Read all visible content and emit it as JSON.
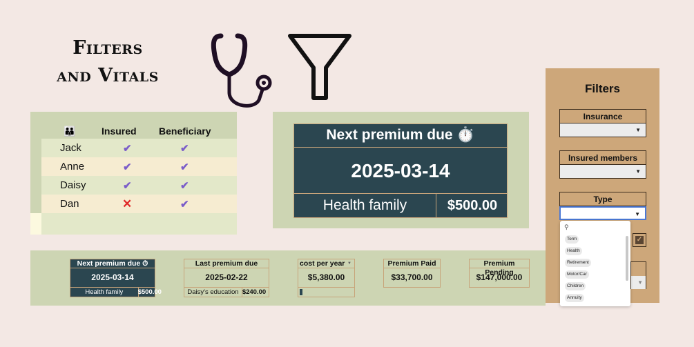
{
  "title": {
    "line1": "Filters",
    "line2": "and Vitals"
  },
  "icons": {
    "stethoscope": "stethoscope-icon",
    "funnel": "funnel-icon"
  },
  "members_table": {
    "header_icon": "👪",
    "col_insured": "Insured",
    "col_beneficiary": "Beneficiary",
    "rows": [
      {
        "name": "Jack",
        "insured": "✔",
        "beneficiary": "✔"
      },
      {
        "name": "Anne",
        "insured": "✔",
        "beneficiary": "✔"
      },
      {
        "name": "Daisy",
        "insured": "✔",
        "beneficiary": "✔"
      },
      {
        "name": "Dan",
        "insured": "✕",
        "beneficiary": "✔"
      }
    ]
  },
  "big_card": {
    "title": "Next premium due ⏱️",
    "date": "2025-03-14",
    "policy": "Health family",
    "amount": "$500.00"
  },
  "summary": {
    "next_premium": {
      "label": "Next premium due ⏱",
      "date": "2025-03-14",
      "policy": "Health family",
      "amount": "$500.00"
    },
    "last_premium": {
      "label": "Last premium due",
      "date": "2025-02-22",
      "policy": "Daisy's education",
      "amount": "$240.00"
    },
    "cost_per_year": {
      "label": "cost per year",
      "value": "$5,380.00",
      "progress": 0.05
    },
    "premium_paid": {
      "label": "Premium Paid",
      "value": "$33,700.00"
    },
    "premium_pending": {
      "label": "Premium Pending",
      "value": "$147,000.00"
    }
  },
  "filters": {
    "title": "Filters",
    "insurance_label": "Insurance",
    "members_label": "Insured members",
    "type_label": "Type",
    "type_options": [
      "Term",
      "Health",
      "Retirement",
      "Motor/Car",
      "Children",
      "Annuity"
    ]
  },
  "colors": {
    "panel": "#cdd5b3",
    "dark": "#2b4650",
    "filters_bg": "#cda77a",
    "check": "#7a5cc9",
    "cross": "#e02a2a"
  }
}
